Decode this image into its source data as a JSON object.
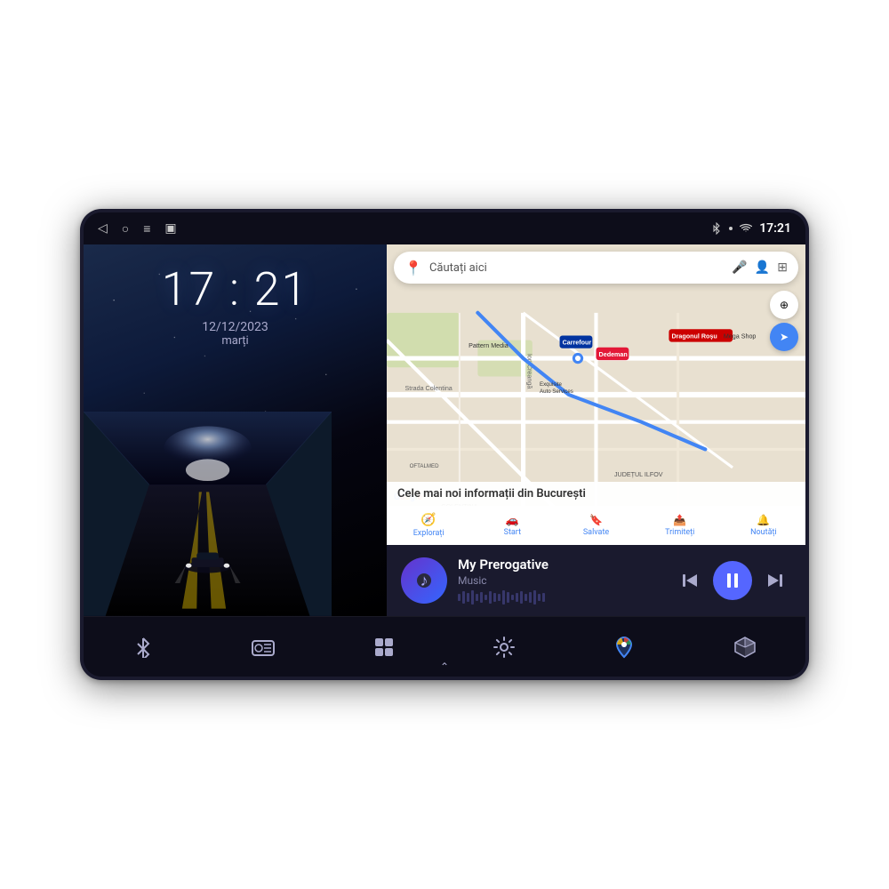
{
  "device": {
    "status_bar": {
      "time": "17:21",
      "icons": {
        "bluetooth": "bluetooth",
        "wifi": "wifi",
        "signal": "signal"
      },
      "nav": {
        "back": "◁",
        "home": "○",
        "menu": "≡",
        "screenshot": "▣"
      }
    }
  },
  "lock_screen": {
    "time": "17 : 21",
    "date": "12/12/2023",
    "day": "marți"
  },
  "map": {
    "search_placeholder": "Căutați aici",
    "info_title": "Cele mai noi informații din București",
    "tabs": [
      {
        "icon": "🧭",
        "label": "Explorați"
      },
      {
        "icon": "🚗",
        "label": "Start"
      },
      {
        "icon": "🔖",
        "label": "Salvate"
      },
      {
        "icon": "📤",
        "label": "Trimiteți"
      },
      {
        "icon": "🔔",
        "label": "Noutăți"
      }
    ]
  },
  "music": {
    "title": "My Prerogative",
    "subtitle": "Music",
    "artwork_icon": "♪",
    "controls": {
      "prev": "⏮",
      "play": "⏸",
      "next": "⏭"
    }
  },
  "dock": {
    "items": [
      {
        "name": "bluetooth",
        "icon": "bluetooth"
      },
      {
        "name": "radio",
        "icon": "radio"
      },
      {
        "name": "apps",
        "icon": "apps"
      },
      {
        "name": "settings",
        "icon": "settings"
      },
      {
        "name": "maps",
        "icon": "maps"
      },
      {
        "name": "cube",
        "icon": "cube"
      }
    ]
  }
}
